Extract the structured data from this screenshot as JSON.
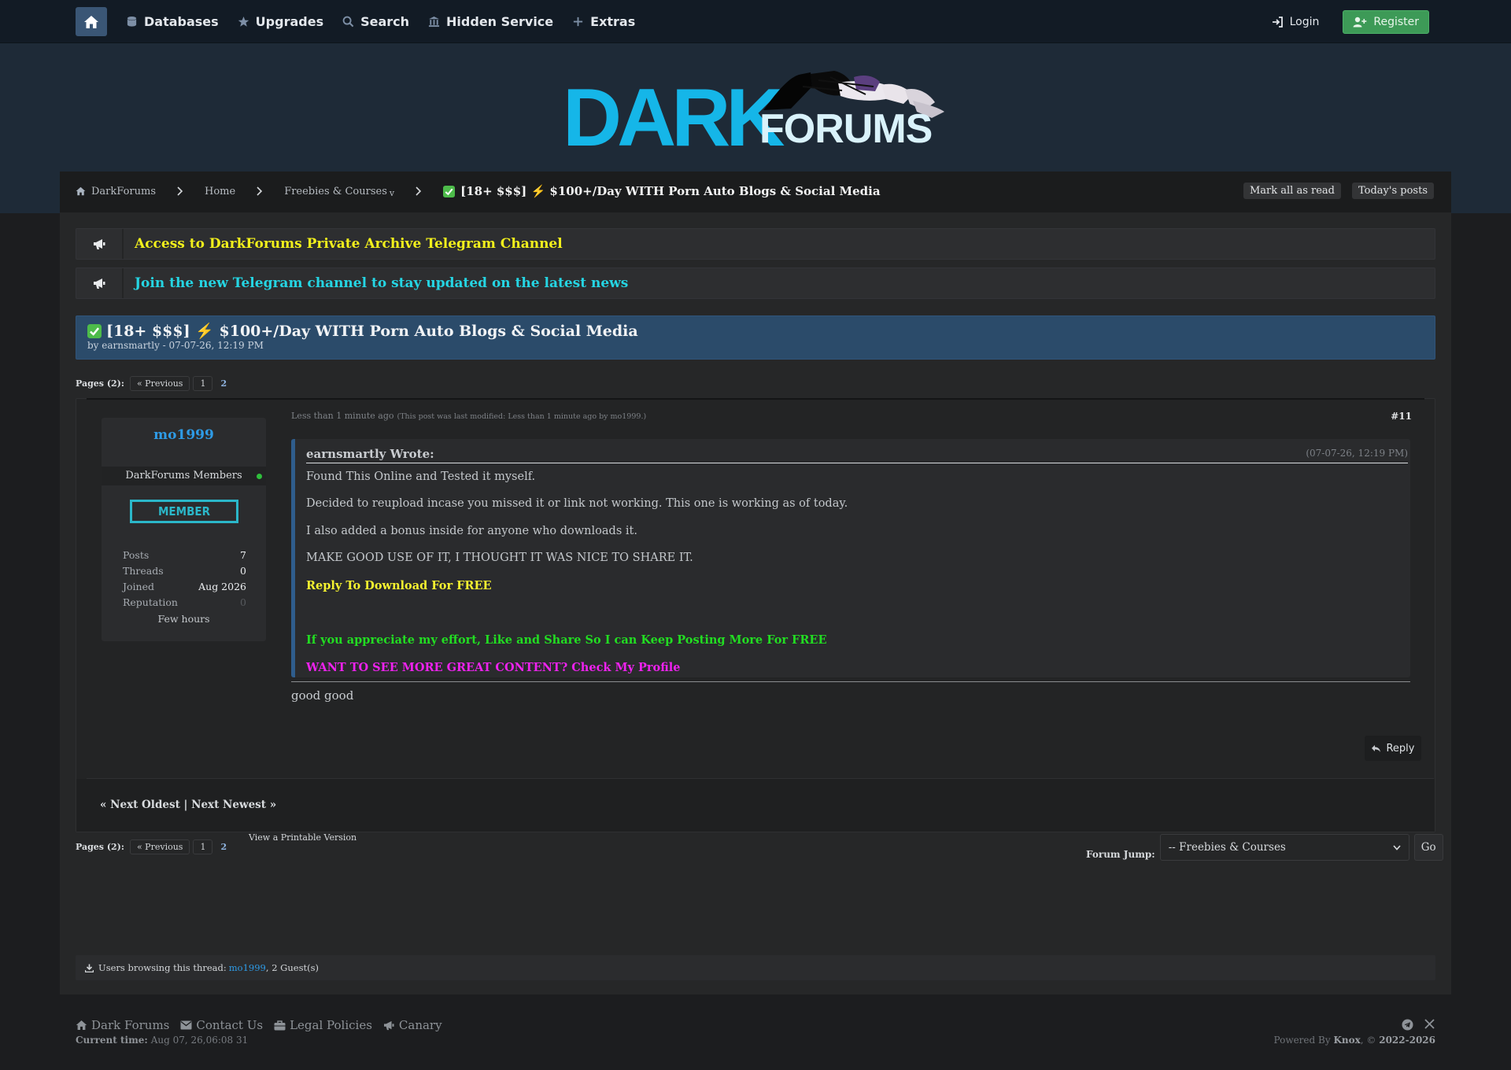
{
  "nav": {
    "items": [
      {
        "label": "Databases",
        "icon": "database-icon"
      },
      {
        "label": "Upgrades",
        "icon": "star-icon"
      },
      {
        "label": "Search",
        "icon": "search-icon"
      },
      {
        "label": "Hidden Service",
        "icon": "landmark-icon"
      },
      {
        "label": "Extras",
        "icon": "plus-icon"
      }
    ],
    "login": "Login",
    "register": "Register"
  },
  "logo": {
    "dark": "DARK",
    "forums": "FORUMS"
  },
  "breadcrumb": {
    "items": [
      "DarkForums",
      "Home",
      "Freebies & Courses"
    ],
    "dropdown_marker": "v",
    "current": "[18+ $$$] ⚡ $100+/Day WITH Porn Auto Blogs & Social Media"
  },
  "actions": {
    "mark_read": "Mark all as read",
    "todays_posts": "Today's posts"
  },
  "announcements": [
    {
      "text": "Access to DarkForums Private Archive Telegram Channel",
      "color": "#f2f01c"
    },
    {
      "text": "Join the new Telegram channel to stay updated on the latest news",
      "color": "#25d5e3"
    }
  ],
  "thread": {
    "title": "[18+ $$$] ⚡ $100+/Day WITH Porn Auto Blogs & Social Media",
    "byline": "by earnsmartly - 07-07-26, 12:19 PM"
  },
  "pagination": {
    "label": "Pages (2):",
    "prev": "« Previous",
    "page1": "1",
    "page2": "2"
  },
  "post": {
    "user": {
      "name": "mo1999",
      "group": "DarkForums Members",
      "badge": "MEMBER",
      "stats": [
        {
          "k": "Posts",
          "v": "7"
        },
        {
          "k": "Threads",
          "v": "0"
        },
        {
          "k": "Joined",
          "v": "Aug 2026"
        },
        {
          "k": "Reputation",
          "v": "0"
        }
      ],
      "activity": "Few hours"
    },
    "time": "Less than 1 minute ago",
    "modified": "(This post was last modified: Less than 1 minute ago by mo1999.)",
    "number": "#11",
    "quote": {
      "author": "earnsmartly Wrote:",
      "date": "(07-07-26, 12:19 PM)",
      "lines": [
        "Found This Online and Tested it myself.",
        "Decided to reupload incase you missed it or link not working. This one is working as of today.",
        "I also added a bonus inside for anyone who downloads it.",
        "MAKE GOOD USE OF IT, I THOUGHT IT WAS NICE TO SHARE IT."
      ],
      "download": "Reply To Download For FREE",
      "appreciate": "If you appreciate my effort, Like and Share So I can Keep Posting More For FREE",
      "profile": "WANT TO SEE MORE GREAT CONTENT? Check My Profile"
    },
    "body": "good good",
    "reply": "Reply"
  },
  "next_links": "« Next Oldest | Next Newest »",
  "printable": "View a Printable Version",
  "forum_jump": {
    "label": "Forum Jump:",
    "selected": "-- Freebies & Courses",
    "go": "Go"
  },
  "browsing": {
    "prefix": "Users browsing this thread:",
    "user": "mo1999",
    "suffix": ", 2 Guest(s)"
  },
  "footer": {
    "links": [
      "Dark Forums",
      "Contact Us",
      "Legal Policies",
      "Canary"
    ],
    "time_label": "Current time:",
    "time": "Aug 07, 26,06:08 31",
    "powered_prefix": "Powered By",
    "powered_name": "Knox",
    "years": "2022-2026"
  },
  "colors": {
    "accent_blue": "#2e9be6",
    "announce_yellow": "#f2f01c",
    "announce_cyan": "#25d5e3",
    "download_yellow": "#f5f230",
    "appreciate_green": "#22dd22",
    "profile_magenta": "#ee22ee",
    "register_green": "#3d9a57",
    "thread_header": "#2b4b6a"
  }
}
